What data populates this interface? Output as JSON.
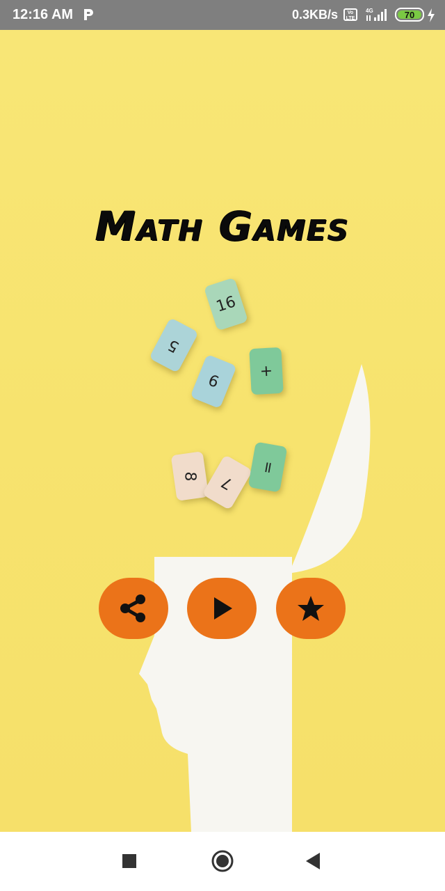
{
  "status_bar": {
    "time": "12:16 AM",
    "network_speed": "0.3KB/s",
    "volte_label": "Vo LTE",
    "network_type": "4G",
    "battery_percent": "70",
    "icons": [
      "parking-app-icon",
      "volte-icon",
      "signal-icon",
      "battery-icon",
      "charging-icon"
    ]
  },
  "app": {
    "title": "Math Games",
    "tiles": [
      "16",
      "5",
      "6",
      "+",
      "8",
      "7",
      "="
    ]
  },
  "actions": {
    "share_icon": "share-icon",
    "play_icon": "play-icon",
    "rate_icon": "star-icon",
    "button_color": "#eb7319"
  },
  "nav_bar": {
    "icons": [
      "recents-square-icon",
      "home-circle-icon",
      "back-triangle-icon"
    ]
  }
}
